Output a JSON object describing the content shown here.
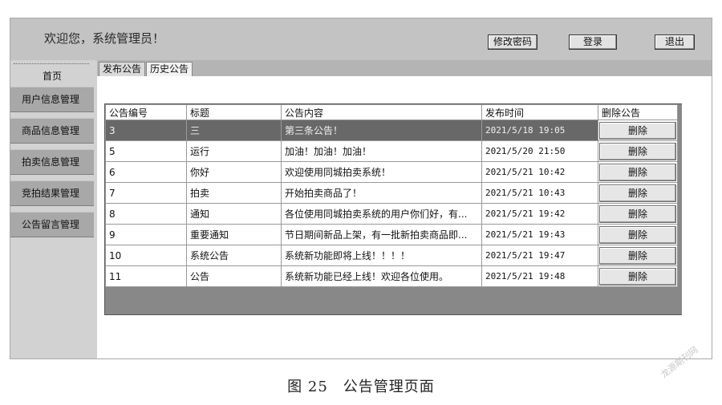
{
  "header": {
    "welcome": "欢迎您，系统管理员！",
    "buttons": {
      "change_password": "修改密码",
      "login": "登录",
      "logout": "退出"
    }
  },
  "sidebar": {
    "home": "首页",
    "items": [
      {
        "label": "用户信息管理"
      },
      {
        "label": "商品信息管理"
      },
      {
        "label": "拍卖信息管理"
      },
      {
        "label": "竞拍结果管理"
      },
      {
        "label": "公告留言管理"
      }
    ]
  },
  "tabs": [
    {
      "label": "发布公告"
    },
    {
      "label": "历史公告"
    }
  ],
  "table": {
    "headers": [
      "公告编号",
      "标题",
      "公告内容",
      "发布时间",
      "删除公告"
    ],
    "delete_label": "删除",
    "rows": [
      {
        "id": "3",
        "title": "三",
        "content": "第三条公告！",
        "time": "2021/5/18 19:05"
      },
      {
        "id": "5",
        "title": "运行",
        "content": "加油！加油！加油！",
        "time": "2021/5/20 21:50"
      },
      {
        "id": "6",
        "title": "你好",
        "content": "欢迎使用同城拍卖系统！",
        "time": "2021/5/21 10:42"
      },
      {
        "id": "7",
        "title": "拍卖",
        "content": "开始拍卖商品了！",
        "time": "2021/5/21 10:43"
      },
      {
        "id": "8",
        "title": "通知",
        "content": "各位使用同城拍卖系统的用户你们好，有...",
        "time": "2021/5/21 19:42"
      },
      {
        "id": "9",
        "title": "重要通知",
        "content": "节日期间新品上架，有一批新拍卖商品即...",
        "time": "2021/5/21 19:43"
      },
      {
        "id": "10",
        "title": "系统公告",
        "content": "系统新功能即将上线！！！！",
        "time": "2021/5/21 19:47"
      },
      {
        "id": "11",
        "title": "公告",
        "content": "系统新功能已经上线！欢迎各位使用。",
        "time": "2021/5/21 19:48"
      }
    ]
  },
  "caption": "图 25　公告管理页面",
  "watermark": "龙源期刊网"
}
